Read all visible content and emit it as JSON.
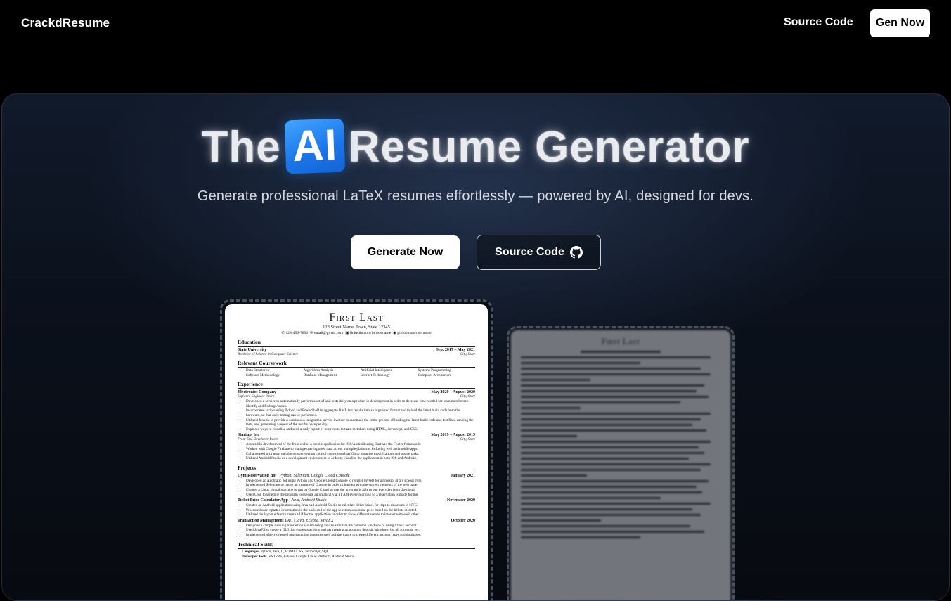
{
  "nav": {
    "brand": "CrackdResume",
    "source_link": "Source Code",
    "gen_button": "Gen Now"
  },
  "hero": {
    "title_prefix": "The",
    "title_badge": "AI",
    "title_suffix": "Resume Generator",
    "subtitle": "Generate professional LaTeX resumes effortlessly — powered by AI, designed for devs.",
    "primary_button": "Generate Now",
    "secondary_button": "Source Code",
    "secondary_icon": "github-icon",
    "accent_color": "#1a74e8"
  },
  "resume": {
    "name": "First Last",
    "address": "123 Street Name, Town, State 12345",
    "contact": [
      "123-456-7890",
      "email@gmail.com",
      "linkedin.com/in/username",
      "github.com/username"
    ],
    "education": {
      "title": "Education",
      "school": "State University",
      "dates": "Sep. 2017 – May 2021",
      "degree": "Bachelor of Science in Computer Science",
      "location": "City, State"
    },
    "coursework": {
      "title": "Relevant Coursework",
      "items": [
        "Data Structures",
        "Algorithms Analysis",
        "Artificial Intelligence",
        "Systems Programming",
        "Software Methodology",
        "Database Management",
        "Internet Technology",
        "Computer Architecture"
      ]
    },
    "experience": {
      "title": "Experience",
      "jobs": [
        {
          "company": "Electronics Company",
          "dates": "May 2020 – August 2020",
          "role": "Software Engineer Intern",
          "location": "City, State",
          "bullets": [
            "Developed a service to automatically perform a set of unit tests daily on a product in development in order to decrease time needed for team members to identify and fix bugs/issues.",
            "Incorporated scripts using Python and PowerShell to aggregate XML test results into an organized format and to load the latest build code onto the hardware, so that daily testing can be performed.",
            "Utilized Jenkins to provide a continuous integration service in order to automate the entire process of loading the latest build code and test files, running the tests, and generating a report of the results once per day.",
            "Explored ways to visualize and send a daily report of test results to team members using HTML, Javascript, and CSS."
          ]
        },
        {
          "company": "Startup, Inc",
          "dates": "May 2019 – August 2019",
          "role": "Front End Developer Intern",
          "location": "City, State",
          "bullets": [
            "Assisted in development of the front end of a mobile application for iOS/Android using Dart and the Flutter framework.",
            "Worked with Google Firebase to manage user inputted data across multiple platforms including web and mobile apps.",
            "Collaborated with team members using version control systems such as Git to organize modifications and assign tasks.",
            "Utilized Android Studio as a development environment in order to visualize the application in both iOS and Android."
          ]
        }
      ]
    },
    "projects": {
      "title": "Projects",
      "items": [
        {
          "name": "Gym Reservation Bot",
          "tech": "Python, Selenium, Google Cloud Console",
          "date": "January 2021",
          "bullets": [
            "Developed an automatic bot using Python and Google Cloud Console to register myself for a timeslot at my school gym.",
            "Implemented Selenium to create an instance of Chrome in order to interact with the correct elements of the web page.",
            "Created a Linux virtual machine to run on Google Cloud so that the program is able to run everyday from the cloud.",
            "Used Cron to schedule the program to execute automatically at 11 AM every morning so a reservation is made for me."
          ]
        },
        {
          "name": "Ticket Price Calculator App",
          "tech": "Java, Android Studio",
          "date": "November 2020",
          "bullets": [
            "Created an Android application using Java and Android Studio to calculate ticket prices for trips to museums in NYC.",
            "Processed user inputted information in the back-end of the app to return a subtotal price based on the tickets selected.",
            "Utilized the layout editor to create a UI for the application in order to allow different scenes to interact with each other."
          ]
        },
        {
          "name": "Transaction Management GUI",
          "tech": "Java, Eclipse, JavaFX",
          "date": "October 2020",
          "bullets": [
            "Designed a sample banking transaction system using Java to simulate the common functions of using a bank account.",
            "Used JavaFX to create a GUI that supports actions such as creating an account, deposit, withdraw, list all accounts, etc.",
            "Implemented object-oriented programming practices such as inheritance to create different account types and databases."
          ]
        }
      ]
    },
    "skills": {
      "title": "Technical Skills",
      "languages_label": "Languages",
      "languages": "Python, Java, C, HTML/CSS, JavaScript, SQL",
      "tools_label": "Developer Tools",
      "tools": "VS Code, Eclipse, Google Cloud Platform, Android Studio"
    }
  }
}
